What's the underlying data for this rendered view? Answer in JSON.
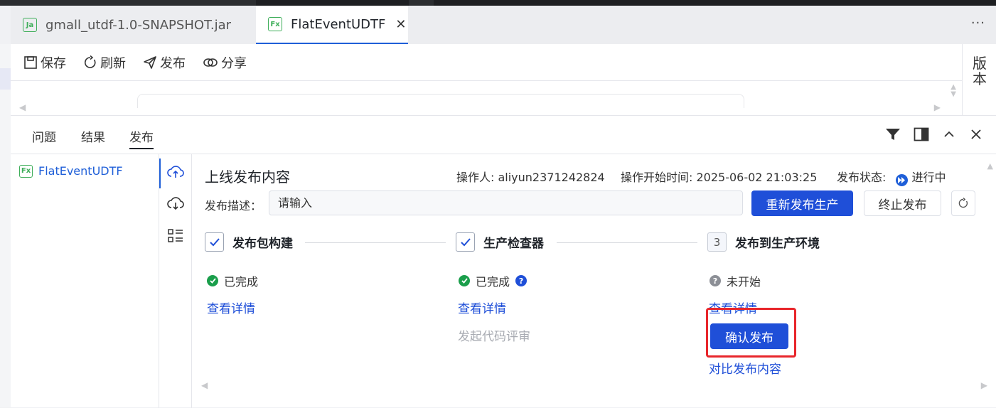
{
  "tabs": [
    {
      "label": "gmall_utdf-1.0-SNAPSHOT.jar",
      "badge": "Ja",
      "active": false
    },
    {
      "label": "FlatEventUDTF",
      "badge": "Fx",
      "active": true
    }
  ],
  "more_label": "···",
  "toolbar": {
    "save": "保存",
    "refresh": "刷新",
    "publish": "发布",
    "share": "分享"
  },
  "version_panel": {
    "label": "版本"
  },
  "bottom_tabs": [
    "问题",
    "结果",
    "发布"
  ],
  "file_tree": [
    {
      "label": "FlatEventUDTF",
      "badge": "Fx"
    }
  ],
  "publish": {
    "title": "上线发布内容",
    "operator": "操作人: aliyun2371242824",
    "start_time": "操作开始时间: 2025-06-02 21:03:25",
    "status_label": "发布状态:",
    "status_value": "进行中",
    "desc_label": "发布描述：",
    "desc_placeholder": "请输入",
    "republish_btn": "重新发布生产",
    "abort_btn": "终止发布",
    "steps": [
      {
        "title": "发布包构建",
        "status": "已完成",
        "detail_link": "查看详情"
      },
      {
        "title": "生产检查器",
        "status": "已完成",
        "detail_link": "查看详情",
        "extra": "发起代码评审"
      },
      {
        "number": "3",
        "title": "发布到生产环境",
        "status": "未开始",
        "detail_link": "查看详情",
        "confirm_btn": "确认发布",
        "compare_link": "对比发布内容"
      }
    ]
  },
  "colors": {
    "primary": "#1f4fd8",
    "success": "#1a9e4b",
    "highlight_border": "#e8262b"
  }
}
